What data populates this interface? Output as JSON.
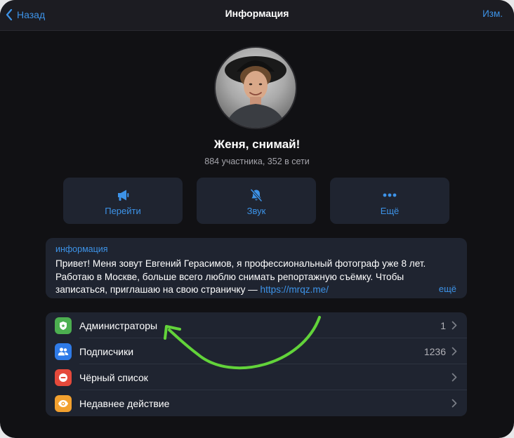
{
  "header": {
    "back_label": "Назад",
    "title": "Информация",
    "edit_label": "Изм."
  },
  "channel": {
    "name": "Женя, снимай!",
    "meta": "884 участника, 352 в сети"
  },
  "actions": [
    {
      "label": "Перейти",
      "icon": "megaphone-icon"
    },
    {
      "label": "Звук",
      "icon": "bell-muted-icon"
    },
    {
      "label": "Ещё",
      "icon": "more-dots-icon"
    }
  ],
  "info": {
    "caption": "информация",
    "text": "Привет! Меня зовут Евгений Герасимов, я профессиональный фотограф уже 8 лет. Работаю в Москве, больше всего люблю снимать репортажную съёмку. Чтобы записаться, приглашаю на свою страничку — ",
    "link": "https://mrqz.me/",
    "more_label": "ещё"
  },
  "list": [
    {
      "label": "Администраторы",
      "count": "1",
      "icon": "shield-icon",
      "color": "#4caf50"
    },
    {
      "label": "Подписчики",
      "count": "1236",
      "icon": "users-icon",
      "color": "#2f7be8"
    },
    {
      "label": "Чёрный список",
      "count": "",
      "icon": "block-icon",
      "color": "#e5493b"
    },
    {
      "label": "Недавнее действие",
      "count": "",
      "icon": "eye-icon",
      "color": "#f2a02f"
    }
  ],
  "colors": {
    "accent": "#3d93e8",
    "background": "#111114",
    "card": "#1f2430",
    "annotation_arrow": "#62d33a"
  }
}
